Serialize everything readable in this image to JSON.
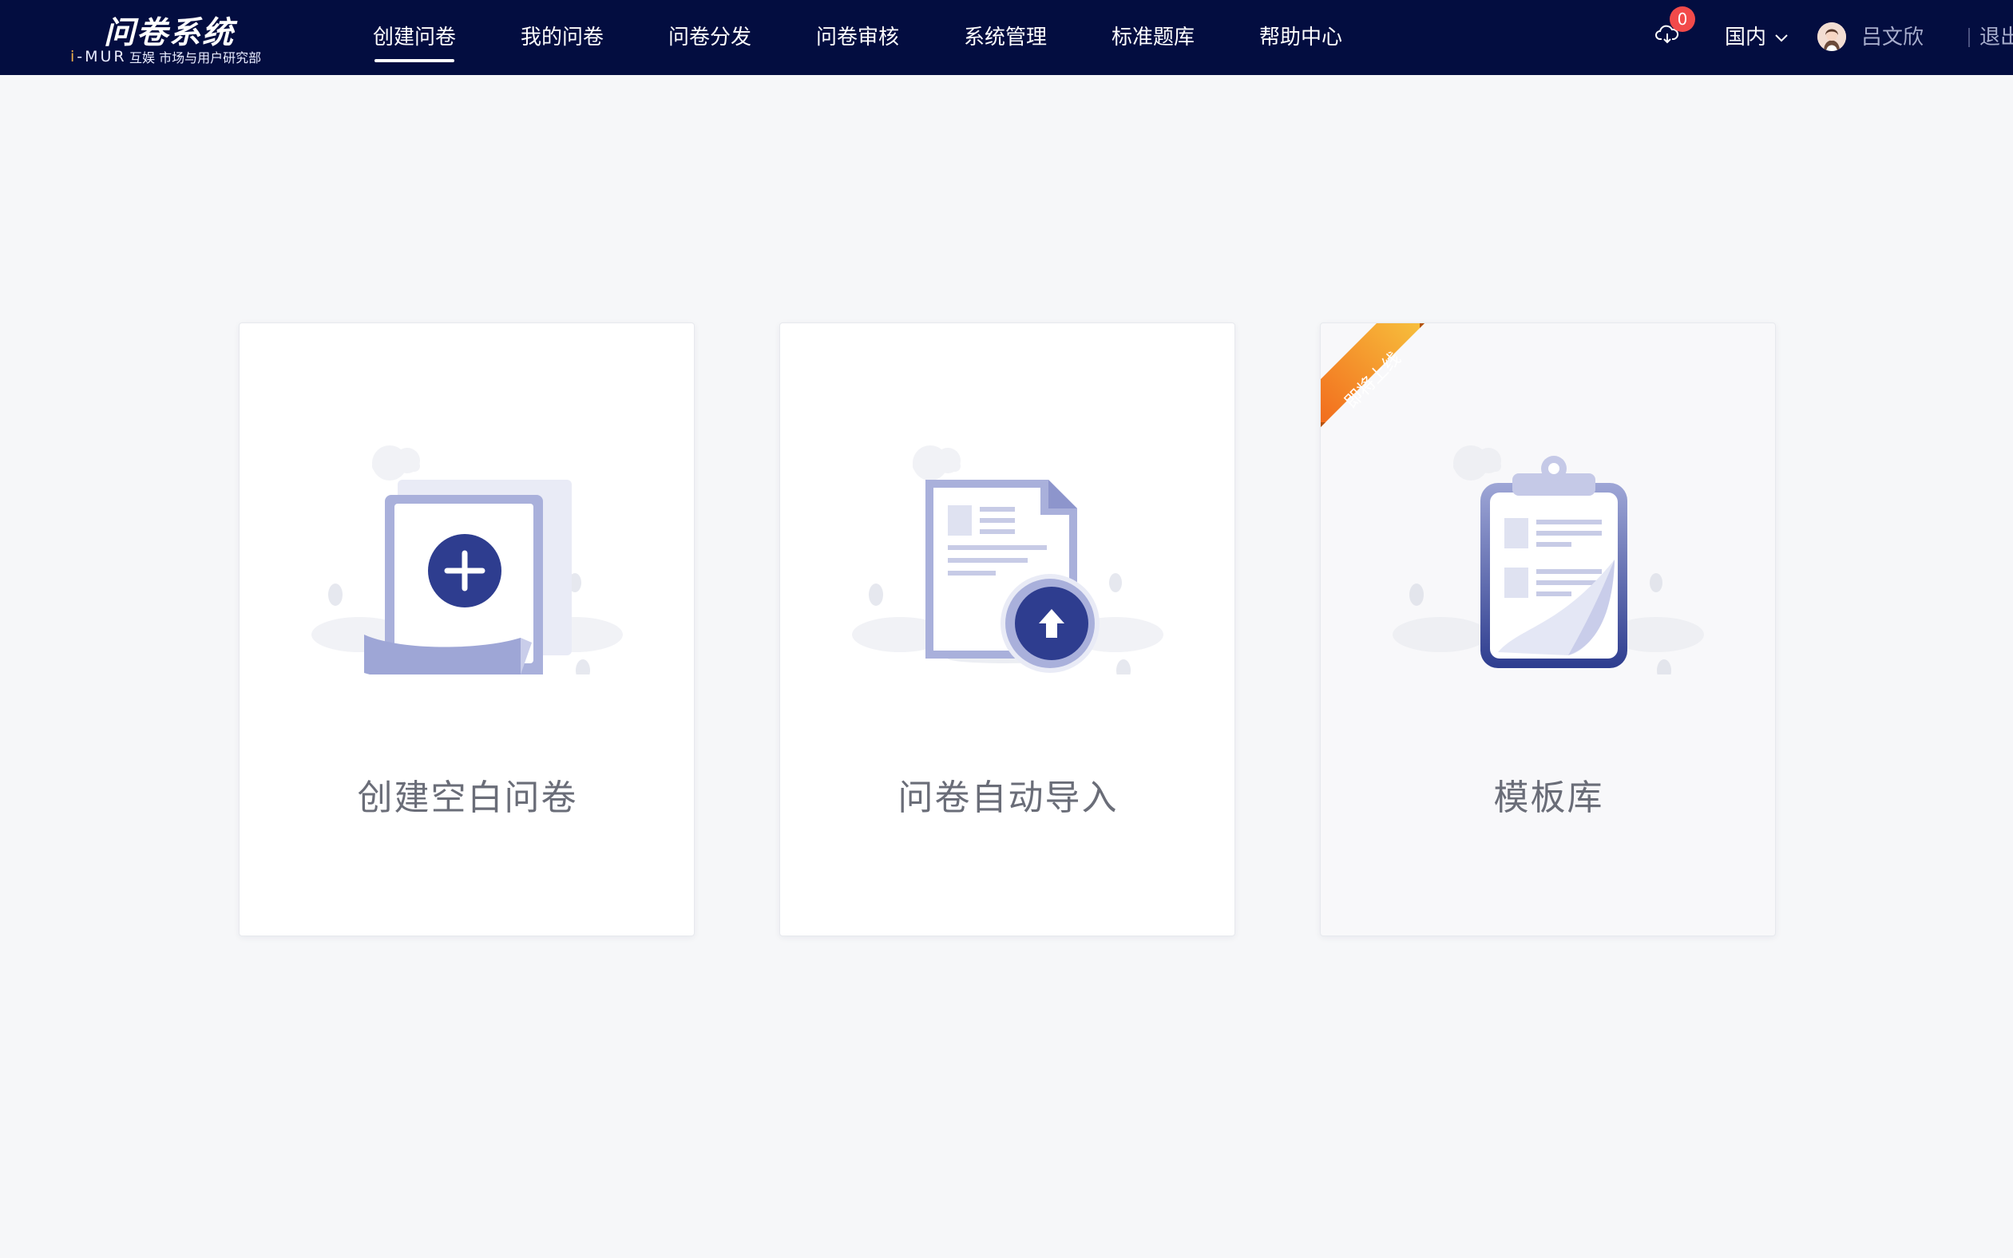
{
  "app": {
    "logo_title": "问卷系统",
    "logo_mark": "i-MUR",
    "logo_subtitle": "互娱 市场与用户研究部"
  },
  "nav": {
    "items": [
      {
        "label": "创建问卷",
        "active": true
      },
      {
        "label": "我的问卷",
        "active": false
      },
      {
        "label": "问卷分发",
        "active": false
      },
      {
        "label": "问卷审核",
        "active": false
      },
      {
        "label": "系统管理",
        "active": false
      },
      {
        "label": "标准题库",
        "active": false
      },
      {
        "label": "帮助中心",
        "active": false
      }
    ]
  },
  "toolbar": {
    "download_count": "0",
    "region": "国内",
    "username": "吕文欣",
    "logout": "退出"
  },
  "cards": [
    {
      "label": "创建空白问卷",
      "icon": "blank-document-plus-icon"
    },
    {
      "label": "问卷自动导入",
      "icon": "document-upload-icon"
    },
    {
      "label": "模板库",
      "icon": "clipboard-template-icon",
      "ribbon": "即将上线"
    }
  ],
  "colors": {
    "nav_bg": "#030d40",
    "page_bg": "#f6f7f9",
    "accent_blue": "#2e3d8f",
    "icon_light": "#aab0d8",
    "badge_red": "#f24a4a",
    "ribbon_orange": "#f5a623"
  }
}
